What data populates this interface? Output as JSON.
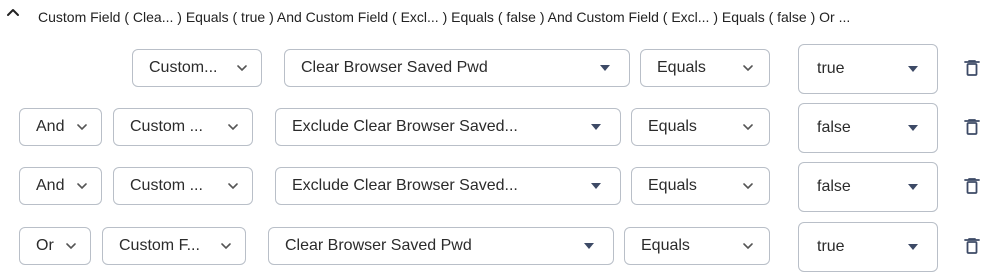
{
  "summary": {
    "text": "Custom Field ( Clea... ) Equals ( true ) And Custom Field ( Excl... ) Equals ( false ) And Custom Field ( Excl... ) Equals ( false ) Or ..."
  },
  "icons": {
    "collapse": "chevron-up-icon",
    "dropdown": "chevron-down-icon",
    "select": "caret-down-icon",
    "delete": "trash-icon"
  },
  "rows": [
    {
      "connector": "",
      "field_type": "Custom...",
      "field": "Clear Browser Saved Pwd",
      "operator": "Equals",
      "value": "true"
    },
    {
      "connector": "And",
      "field_type": "Custom ...",
      "field": "Exclude Clear Browser Saved...",
      "operator": "Equals",
      "value": "false"
    },
    {
      "connector": "And",
      "field_type": "Custom ...",
      "field": "Exclude Clear Browser Saved...",
      "operator": "Equals",
      "value": "false"
    },
    {
      "connector": "Or",
      "field_type": "Custom F...",
      "field": "Clear Browser Saved Pwd",
      "operator": "Equals",
      "value": "true"
    }
  ],
  "colors": {
    "border": "#b9bfc8",
    "text": "#2b2b2b",
    "icon": "#3d4a66"
  }
}
